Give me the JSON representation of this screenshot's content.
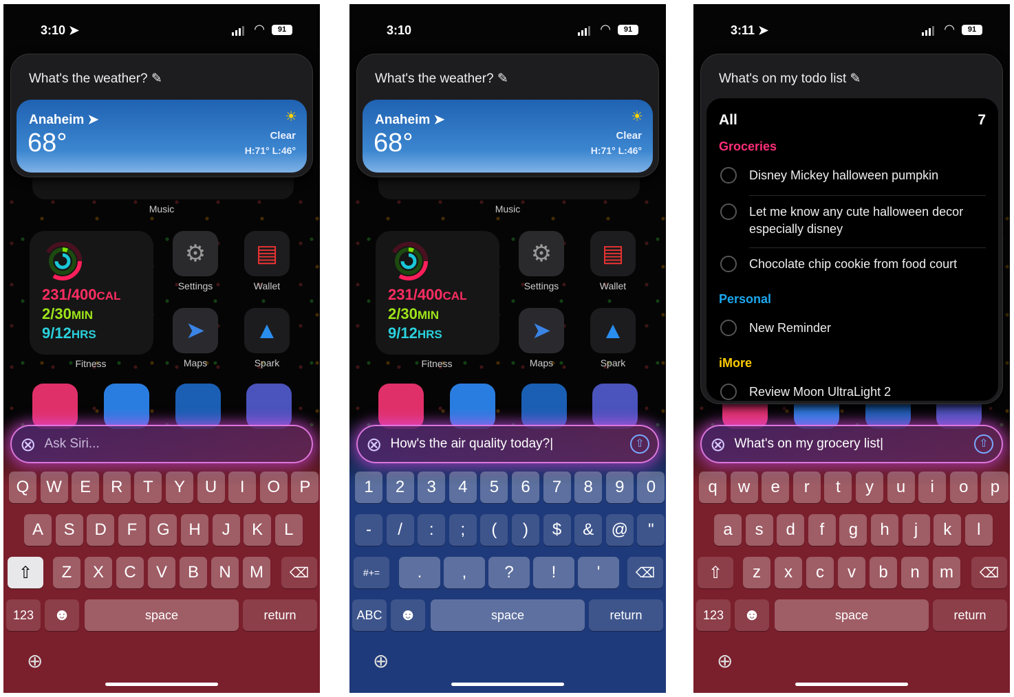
{
  "phones": [
    {
      "time": "3:10",
      "location_arrow": true,
      "battery": "91",
      "query": "What's the weather?",
      "weather": {
        "city": "Anaheim",
        "temp": "68°",
        "condition": "Clear",
        "hilo": "H:71° L:46°"
      },
      "home": {
        "music": "Music",
        "fitness_label": "Fitness",
        "fitness": {
          "cal": "231/400",
          "cal_unit": "CAL",
          "min": "2/30",
          "min_unit": "MIN",
          "hrs": "9/12",
          "hrs_unit": "HRS"
        },
        "apps": [
          "Settings",
          "Wallet",
          "Maps",
          "Spark"
        ]
      },
      "siri": {
        "value": "",
        "placeholder": "Ask Siri...",
        "send_button": false
      },
      "keyboard": {
        "type": "letters",
        "rows": [
          [
            "Q",
            "W",
            "E",
            "R",
            "T",
            "Y",
            "U",
            "I",
            "O",
            "P"
          ],
          [
            "A",
            "S",
            "D",
            "F",
            "G",
            "H",
            "J",
            "K",
            "L"
          ],
          [
            "Z",
            "X",
            "C",
            "V",
            "B",
            "N",
            "M"
          ]
        ],
        "mode_key": "123",
        "space": "space",
        "return": "return",
        "shift_active": true
      },
      "theme": {
        "keyboard_tint": "#7a1f2c"
      }
    },
    {
      "time": "3:10",
      "location_arrow": false,
      "battery": "91",
      "query": "What's the weather?",
      "weather": {
        "city": "Anaheim",
        "temp": "68°",
        "condition": "Clear",
        "hilo": "H:71° L:46°"
      },
      "home": {
        "music": "Music",
        "fitness_label": "Fitness",
        "fitness": {
          "cal": "231/400",
          "cal_unit": "CAL",
          "min": "2/30",
          "min_unit": "MIN",
          "hrs": "9/12",
          "hrs_unit": "HRS"
        },
        "apps": [
          "Settings",
          "Wallet",
          "Maps",
          "Spark"
        ]
      },
      "siri": {
        "value": "How's the air quality today?",
        "placeholder": "",
        "send_button": true
      },
      "keyboard": {
        "type": "symbols",
        "rows": [
          [
            "1",
            "2",
            "3",
            "4",
            "5",
            "6",
            "7",
            "8",
            "9",
            "0"
          ],
          [
            "-",
            "/",
            ":",
            ";",
            "(",
            ")",
            "$",
            "&",
            "@",
            "\""
          ],
          [
            ".",
            ",",
            "?",
            "!",
            "'"
          ]
        ],
        "shift_key": "#+=",
        "mode_key": "ABC",
        "space": "space",
        "return": "return"
      },
      "theme": {
        "keyboard_tint": "#1f3a7a"
      }
    },
    {
      "time": "3:11",
      "location_arrow": true,
      "battery": "91",
      "query": "What's on my todo list",
      "todo": {
        "title": "All",
        "count": "7",
        "sections": [
          {
            "name": "Groceries",
            "color": "#ff2d78",
            "items": [
              "Disney Mickey halloween pumpkin",
              "Let me know any cute halloween decor especially disney",
              "Chocolate chip cookie from food court"
            ]
          },
          {
            "name": "Personal",
            "color": "#1ba8f0",
            "items": [
              "New Reminder"
            ]
          },
          {
            "name": "iMore",
            "color": "#ffcc00",
            "items": [
              "Review Moon UltraLight 2"
            ]
          }
        ]
      },
      "siri": {
        "value": "What's on my grocery list",
        "placeholder": "",
        "send_button": true
      },
      "keyboard": {
        "type": "letters",
        "rows": [
          [
            "q",
            "w",
            "e",
            "r",
            "t",
            "y",
            "u",
            "i",
            "o",
            "p"
          ],
          [
            "a",
            "s",
            "d",
            "f",
            "g",
            "h",
            "j",
            "k",
            "l"
          ],
          [
            "z",
            "x",
            "c",
            "v",
            "b",
            "n",
            "m"
          ]
        ],
        "mode_key": "123",
        "space": "space",
        "return": "return",
        "shift_active": false
      },
      "theme": {
        "keyboard_tint": "#7a1f2c"
      }
    }
  ],
  "icons": {
    "pencil": "pencil-icon",
    "location": "location-arrow-icon",
    "sun": "sun-icon",
    "siri": "siri-icon",
    "send": "arrow-up-circle-icon",
    "globe": "globe-icon",
    "shift": "shift-icon",
    "delete": "delete-icon",
    "emoji": "emoji-icon"
  }
}
